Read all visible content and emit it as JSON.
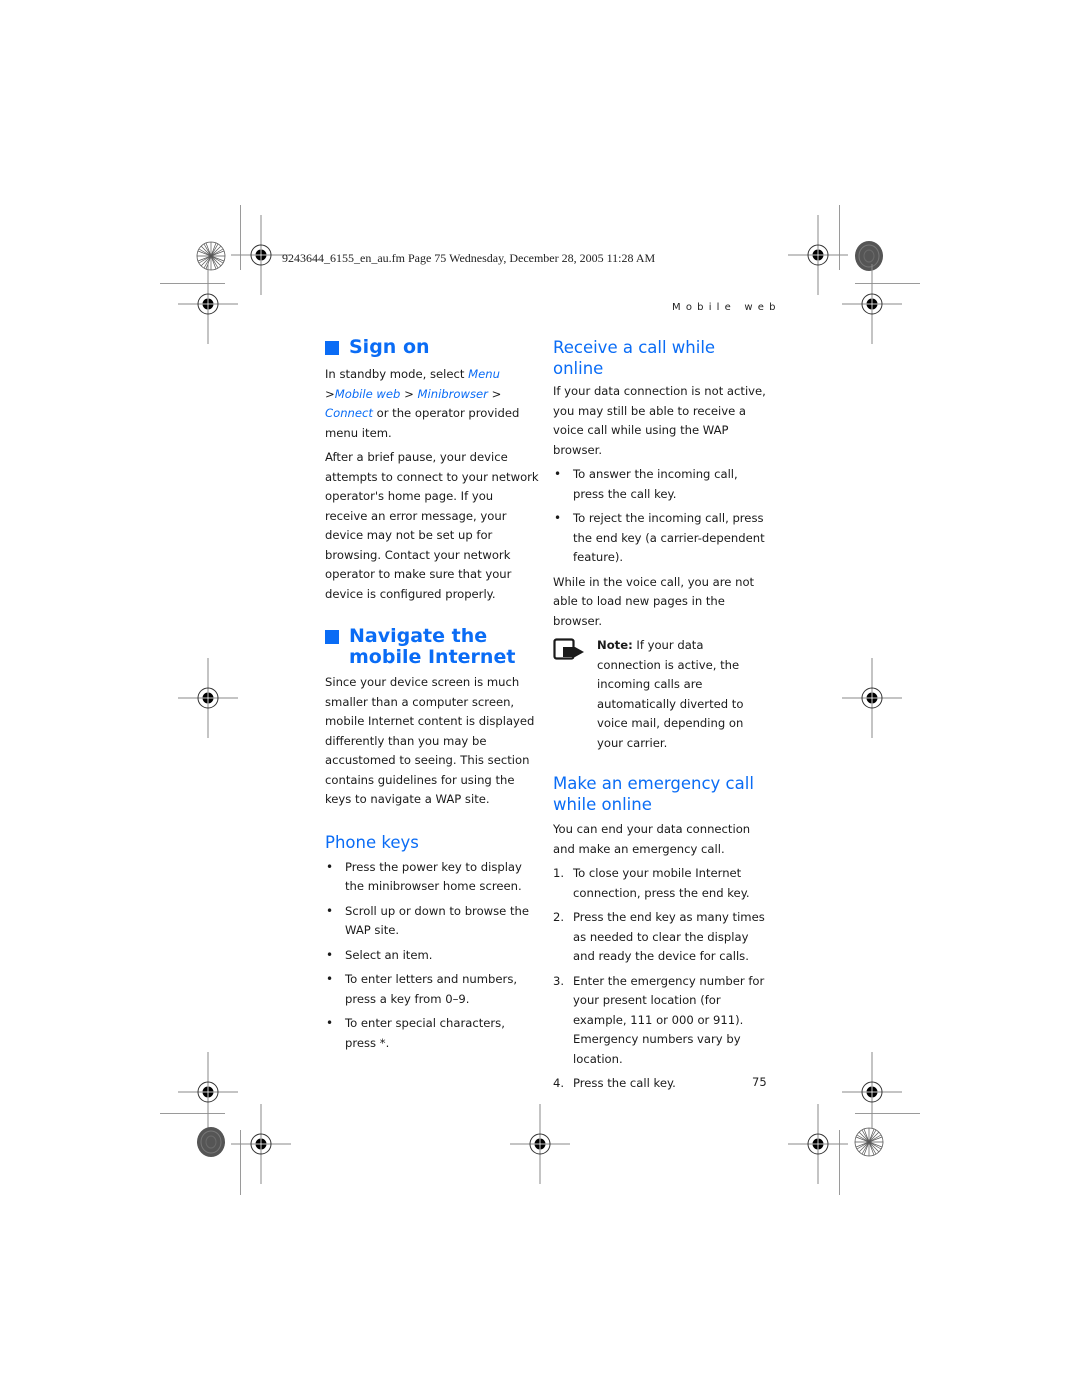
{
  "print_header": {
    "file_info": "9243644_6155_en_au.fm  Page 75  Wednesday, December 28, 2005  11:28 AM",
    "running_head": "Mobile web"
  },
  "left_column": {
    "sign_on": {
      "title": "Sign on",
      "intro_prefix": "In standby mode, select ",
      "menu_path": [
        {
          "text": "Menu",
          "sep": " >"
        },
        {
          "text": "Mobile web",
          "sep": " > "
        },
        {
          "text": "Minibrowser",
          "sep": " > "
        },
        {
          "text": "Connect",
          "sep": ""
        }
      ],
      "intro_suffix": " or the operator provided menu item.",
      "body": "After a brief pause, your device attempts to connect to your network operator's home page. If you receive an error message, your device may not be set up for browsing. Contact your network operator to make sure that your device is configured properly."
    },
    "navigate": {
      "title": "Navigate the mobile Internet",
      "body": "Since your device screen is much smaller than a computer screen, mobile Internet content is displayed differently than you may be accustomed to seeing. This section contains guidelines for using the keys to navigate a WAP site."
    },
    "phone_keys": {
      "title": "Phone keys",
      "items": [
        "Press the power key to display the minibrowser home screen.",
        "Scroll up or down to browse the WAP site.",
        "Select an item.",
        "To enter letters and numbers, press a key from 0–9.",
        "To enter special characters, press *."
      ]
    }
  },
  "right_column": {
    "receive_call": {
      "title": "Receive a call while online",
      "body": "If your data connection is not active, you may still be able to receive a voice call while using the WAP browser.",
      "items": [
        "To answer the incoming call, press the call key.",
        "To reject the incoming call, press the end key (a carrier-dependent feature)."
      ],
      "after": "While in the voice call, you are not able to load new pages in the browser.",
      "note_label": "Note:",
      "note_text": " If your data connection is active, the incoming calls are automatically diverted to voice mail, depending on your carrier."
    },
    "emergency": {
      "title": "Make an emergency call while online",
      "body": "You can end your data connection and make an emergency call.",
      "steps": [
        {
          "n": "1.",
          "text": "To close your mobile Internet connection, press the end key."
        },
        {
          "n": "2.",
          "text": "Press the end key as many times as needed to clear the display and ready the device for calls."
        },
        {
          "n": "3.",
          "text": "Enter the emergency number for your present location (for example, 111 or 000 or 911). Emergency numbers vary by location."
        },
        {
          "n": "4.",
          "text": "Press the call key."
        }
      ]
    }
  },
  "footer": {
    "page_number": "75"
  },
  "colors": {
    "accent": "#0a6cf5",
    "text": "#1a1a1a"
  }
}
